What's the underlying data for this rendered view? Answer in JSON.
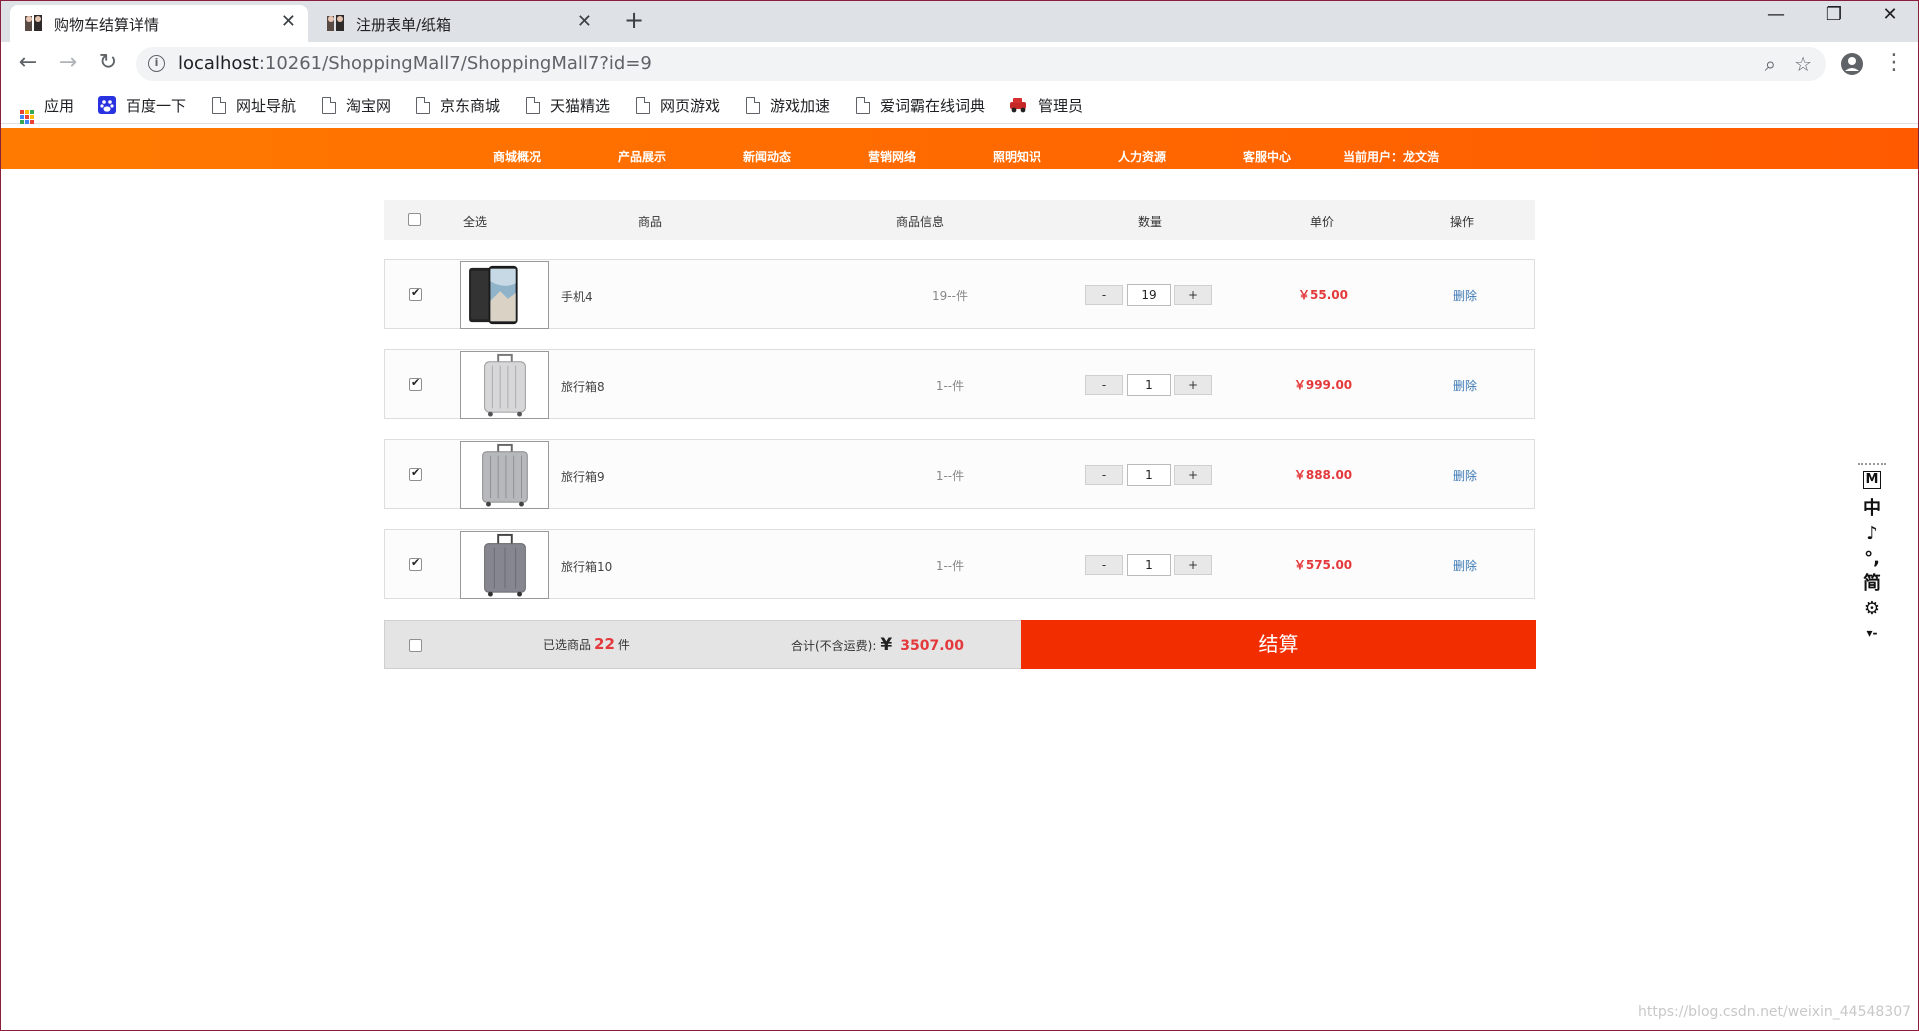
{
  "browser": {
    "tabs": [
      {
        "title": "购物车结算详情",
        "close": "✕"
      },
      {
        "title": "注册表单/纸箱",
        "close": "✕"
      }
    ],
    "new_tab": "+",
    "window_controls": {
      "minimize": "—",
      "restore": "❐",
      "close": "✕"
    },
    "url_host": "localhost",
    "url_rest": ":10261/ShoppingMall7/ShoppingMall7?id=9",
    "bookmarks": [
      "应用",
      "百度一下",
      "网址导航",
      "淘宝网",
      "京东商城",
      "天猫精选",
      "网页游戏",
      "游戏加速",
      "爱词霸在线词典",
      "管理员"
    ]
  },
  "site_nav": {
    "items": [
      "商城概况",
      "产品展示",
      "新闻动态",
      "营销网络",
      "照明知识",
      "人力资源",
      "客服中心",
      "当前用户：龙文浩"
    ]
  },
  "cart": {
    "headers": {
      "select_all": "全选",
      "product": "商品",
      "product_info": "商品信息",
      "quantity": "数量",
      "unit_price": "单价",
      "action": "操作"
    },
    "rows": [
      {
        "name": "手机4",
        "info": "19--件",
        "qty": "19",
        "price": "￥55.00",
        "delete": "删除",
        "image": "phone-image"
      },
      {
        "name": "旅行箱8",
        "info": "1--件",
        "qty": "1",
        "price": "￥999.00",
        "delete": "删除",
        "image": "suitcase-image"
      },
      {
        "name": "旅行箱9",
        "info": "1--件",
        "qty": "1",
        "price": "￥888.00",
        "delete": "删除",
        "image": "suitcase-image"
      },
      {
        "name": "旅行箱10",
        "info": "1--件",
        "qty": "1",
        "price": "￥575.00",
        "delete": "删除",
        "image": "suitcase-image"
      }
    ],
    "minus": "-",
    "plus": "+",
    "summary": {
      "selected_prefix": "已选商品",
      "selected_count": "22",
      "selected_suffix": "件",
      "total_label": "合计(不含运费):",
      "currency": "¥",
      "total_value": "3507.00",
      "checkout": "结算"
    }
  },
  "ime": {
    "keys": [
      "M",
      "中",
      "♪",
      "°,",
      "简",
      "⚙",
      "▾-"
    ]
  },
  "watermark": "https://blog.csdn.net/weixin_44548307",
  "colors": {
    "nav_start": "#ff7a00",
    "nav_end": "#ff5a00",
    "price": "#e4393c",
    "checkout": "#f22e00",
    "link": "#3c79b5"
  }
}
